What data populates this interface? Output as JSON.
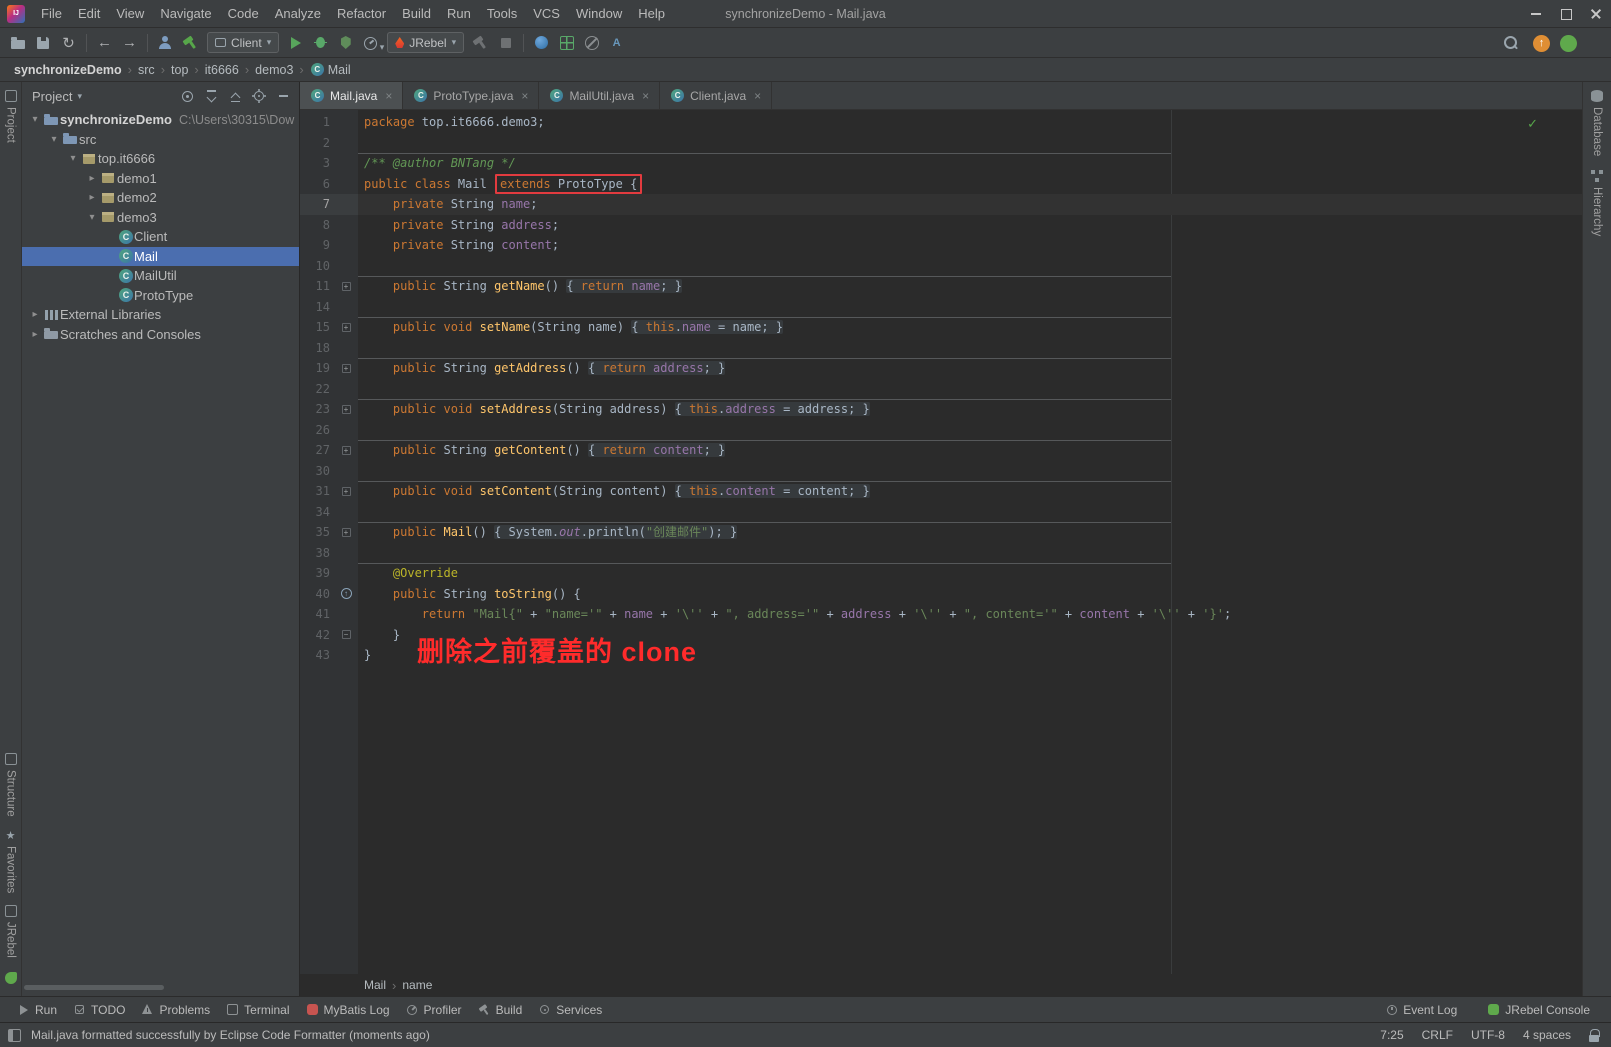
{
  "colors": {
    "selection": "#4B6EAF",
    "highlight_red": "#E23B3F",
    "note_red": "#FF2B2B",
    "keyword": "#CC7832",
    "string": "#6A8759",
    "field": "#9876AA",
    "method": "#FFC66B",
    "comment": "#629755",
    "annotation": "#BBB529",
    "text": "#A9B7C6"
  },
  "window": {
    "title": "synchronizeDemo - Mail.java",
    "menus": [
      "File",
      "Edit",
      "View",
      "Navigate",
      "Code",
      "Analyze",
      "Refactor",
      "Build",
      "Run",
      "Tools",
      "VCS",
      "Window",
      "Help"
    ]
  },
  "toolbar": {
    "run_config_label": "Client",
    "rebel_label": "JRebel",
    "items": [
      {
        "type": "icon",
        "name": "open-file-icon",
        "k": "open"
      },
      {
        "type": "icon",
        "name": "save-all-icon",
        "k": "save"
      },
      {
        "type": "icon",
        "name": "sync-icon",
        "k": "sync",
        "glyph": "↻"
      },
      {
        "type": "sep"
      },
      {
        "type": "icon",
        "name": "back-icon",
        "k": "back",
        "glyph": "←"
      },
      {
        "type": "icon",
        "name": "forward-icon",
        "k": "fwd",
        "glyph": "→"
      },
      {
        "type": "sep"
      },
      {
        "type": "icon",
        "name": "annotate-user-icon",
        "k": "user"
      },
      {
        "type": "icon",
        "name": "build-project-icon",
        "k": "hammer-green"
      },
      {
        "type": "combo",
        "name": "run-config-select",
        "bind": "run_config_label",
        "icon_k": "app"
      },
      {
        "type": "icon",
        "name": "run-icon",
        "k": "run"
      },
      {
        "type": "icon",
        "name": "debug-icon",
        "k": "bug"
      },
      {
        "type": "icon",
        "name": "coverage-icon",
        "k": "coverage"
      },
      {
        "type": "icon",
        "name": "profiler-icon",
        "k": "profiler",
        "caret": true
      },
      {
        "type": "combo",
        "name": "jrebel-select",
        "bind": "rebel_label",
        "icon_k": "flame"
      },
      {
        "type": "icon",
        "name": "attach-agent-icon",
        "k": "hammer-gray"
      },
      {
        "type": "icon",
        "name": "stop-icon",
        "k": "stop"
      },
      {
        "type": "sep"
      },
      {
        "type": "icon",
        "name": "browser-icon",
        "k": "sphere"
      },
      {
        "type": "icon",
        "name": "mybatis-log-icon",
        "k": "grid"
      },
      {
        "type": "icon",
        "name": "mute-breakpoints-icon",
        "k": "mute"
      },
      {
        "type": "icon",
        "name": "translate-icon",
        "k": "translate",
        "glyph": "A"
      }
    ],
    "right_items": [
      {
        "type": "icon",
        "name": "search-everywhere-icon",
        "k": "search"
      },
      {
        "type": "icon",
        "name": "update-icon",
        "k": "update",
        "glyph": "↑"
      },
      {
        "type": "icon",
        "name": "jrebel-status-icon",
        "k": "rebelstat"
      }
    ]
  },
  "path_bar": {
    "items": [
      "synchronizeDemo",
      "src",
      "top",
      "it6666",
      "demo3",
      "Mail"
    ]
  },
  "stripes": {
    "left_top": [
      "Project"
    ],
    "left_bottom": [
      "Structure",
      "Favorites",
      "JRebel"
    ],
    "right": [
      "Database",
      "Hierarchy"
    ]
  },
  "project": {
    "header": "Project",
    "tree": [
      {
        "label": "synchronizeDemo",
        "suffix": "C:\\Users\\30315\\Dow",
        "level": 0,
        "chevron": "open",
        "icon": "module"
      },
      {
        "label": "src",
        "level": 1,
        "chevron": "open",
        "icon": "folder"
      },
      {
        "label": "top.it6666",
        "level": 2,
        "chevron": "open",
        "icon": "package"
      },
      {
        "label": "demo1",
        "level": 3,
        "chevron": "closed",
        "icon": "package"
      },
      {
        "label": "demo2",
        "level": 3,
        "chevron": "closed",
        "icon": "package"
      },
      {
        "label": "demo3",
        "level": 3,
        "chevron": "open",
        "icon": "package"
      },
      {
        "label": "Client",
        "level": 4,
        "chevron": "none",
        "icon": "class"
      },
      {
        "label": "Mail",
        "level": 4,
        "chevron": "none",
        "icon": "class",
        "selected": true
      },
      {
        "label": "MailUtil",
        "level": 4,
        "chevron": "none",
        "icon": "class"
      },
      {
        "label": "ProtoType",
        "level": 4,
        "chevron": "none",
        "icon": "class"
      },
      {
        "label": "External Libraries",
        "level": 0,
        "chevron": "closed",
        "icon": "library"
      },
      {
        "label": "Scratches and Consoles",
        "level": 0,
        "chevron": "closed",
        "icon": "scratch"
      }
    ]
  },
  "tabs": [
    {
      "label": "Mail.java",
      "active": true
    },
    {
      "label": "ProtoType.java",
      "active": false
    },
    {
      "label": "MailUtil.java",
      "active": false
    },
    {
      "label": "Client.java",
      "active": false
    }
  ],
  "editor": {
    "overlay_note": "删除之前覆盖的 clone",
    "inspection_icon": "✓",
    "lines": [
      {
        "n": "1",
        "t": [
          [
            "kw",
            "package "
          ],
          [
            "pl",
            "top.it6666.demo3;"
          ]
        ]
      },
      {
        "n": "2",
        "t": []
      },
      {
        "n": "3",
        "sep": true,
        "t": [
          [
            "cm",
            "/** @author BNTang */"
          ]
        ]
      },
      {
        "n": "6",
        "t": [
          [
            "kw",
            "public class "
          ],
          [
            "pl",
            "Mail "
          ],
          [
            "@red",
            [
              [
                "kw",
                "extends "
              ],
              [
                "pl",
                "ProtoType "
              ],
              [
                "pl",
                "{"
              ]
            ]
          ]
        ]
      },
      {
        "n": "7",
        "cur": true,
        "t": [
          [
            "kw",
            "    private "
          ],
          [
            "pl",
            "String "
          ],
          [
            "fd",
            "name"
          ],
          [
            "pl",
            ";"
          ]
        ]
      },
      {
        "n": "8",
        "t": [
          [
            "kw",
            "    private "
          ],
          [
            "pl",
            "String "
          ],
          [
            "fd",
            "address"
          ],
          [
            "pl",
            ";"
          ]
        ]
      },
      {
        "n": "9",
        "t": [
          [
            "kw",
            "    private "
          ],
          [
            "pl",
            "String "
          ],
          [
            "fd",
            "content"
          ],
          [
            "pl",
            ";"
          ]
        ]
      },
      {
        "n": "10",
        "t": []
      },
      {
        "n": "11",
        "sep": true,
        "g": "fold",
        "t": [
          [
            "kw",
            "    public "
          ],
          [
            "pl",
            "String "
          ],
          [
            "mt",
            "getName"
          ],
          [
            "pl",
            "() "
          ],
          [
            "@fold",
            [
              [
                "pl",
                "{ "
              ],
              [
                "kw",
                "return "
              ],
              [
                "fd",
                "name"
              ],
              [
                "pl",
                "; }"
              ]
            ]
          ]
        ]
      },
      {
        "n": "14",
        "t": []
      },
      {
        "n": "15",
        "sep": true,
        "g": "fold",
        "t": [
          [
            "kw",
            "    public void "
          ],
          [
            "mt",
            "setName"
          ],
          [
            "pl",
            "(String name) "
          ],
          [
            "@fold",
            [
              [
                "pl",
                "{ "
              ],
              [
                "kw",
                "this"
              ],
              [
                "pl",
                "."
              ],
              [
                "fd",
                "name"
              ],
              [
                "pl",
                " = name; }"
              ]
            ]
          ]
        ]
      },
      {
        "n": "18",
        "t": []
      },
      {
        "n": "19",
        "sep": true,
        "g": "fold",
        "t": [
          [
            "kw",
            "    public "
          ],
          [
            "pl",
            "String "
          ],
          [
            "mt",
            "getAddress"
          ],
          [
            "pl",
            "() "
          ],
          [
            "@fold",
            [
              [
                "pl",
                "{ "
              ],
              [
                "kw",
                "return "
              ],
              [
                "fd",
                "address"
              ],
              [
                "pl",
                "; }"
              ]
            ]
          ]
        ]
      },
      {
        "n": "22",
        "t": []
      },
      {
        "n": "23",
        "sep": true,
        "g": "fold",
        "t": [
          [
            "kw",
            "    public void "
          ],
          [
            "mt",
            "setAddress"
          ],
          [
            "pl",
            "(String address) "
          ],
          [
            "@fold",
            [
              [
                "pl",
                "{ "
              ],
              [
                "kw",
                "this"
              ],
              [
                "pl",
                "."
              ],
              [
                "fd",
                "address"
              ],
              [
                "pl",
                " = address; }"
              ]
            ]
          ]
        ]
      },
      {
        "n": "26",
        "t": []
      },
      {
        "n": "27",
        "sep": true,
        "g": "fold",
        "t": [
          [
            "kw",
            "    public "
          ],
          [
            "pl",
            "String "
          ],
          [
            "mt",
            "getContent"
          ],
          [
            "pl",
            "() "
          ],
          [
            "@fold",
            [
              [
                "pl",
                "{ "
              ],
              [
                "kw",
                "return "
              ],
              [
                "fd",
                "content"
              ],
              [
                "pl",
                "; }"
              ]
            ]
          ]
        ]
      },
      {
        "n": "30",
        "t": []
      },
      {
        "n": "31",
        "sep": true,
        "g": "fold",
        "t": [
          [
            "kw",
            "    public void "
          ],
          [
            "mt",
            "setContent"
          ],
          [
            "pl",
            "(String content) "
          ],
          [
            "@fold",
            [
              [
                "pl",
                "{ "
              ],
              [
                "kw",
                "this"
              ],
              [
                "pl",
                "."
              ],
              [
                "fd",
                "content"
              ],
              [
                "pl",
                " = content; }"
              ]
            ]
          ]
        ]
      },
      {
        "n": "34",
        "t": []
      },
      {
        "n": "35",
        "sep": true,
        "g": "fold",
        "t": [
          [
            "kw",
            "    public "
          ],
          [
            "mt",
            "Mail"
          ],
          [
            "pl",
            "() "
          ],
          [
            "@fold",
            [
              [
                "pl",
                "{ System."
              ],
              [
                "sf",
                "out"
              ],
              [
                "pl",
                ".println("
              ],
              [
                "st",
                "\"创建邮件\""
              ],
              [
                "pl",
                "); }"
              ]
            ]
          ]
        ]
      },
      {
        "n": "38",
        "t": []
      },
      {
        "n": "39",
        "sep": true,
        "t": [
          [
            "an",
            "    @Override"
          ]
        ]
      },
      {
        "n": "40",
        "g": "override",
        "t": [
          [
            "kw",
            "    public "
          ],
          [
            "pl",
            "String "
          ],
          [
            "mt",
            "toString"
          ],
          [
            "pl",
            "() {"
          ]
        ]
      },
      {
        "n": "41",
        "t": [
          [
            "kw",
            "        return "
          ],
          [
            "st",
            "\"Mail{\""
          ],
          [
            "pl",
            " + "
          ],
          [
            "st",
            "\"name='\""
          ],
          [
            "pl",
            " + "
          ],
          [
            "fd",
            "name"
          ],
          [
            "pl",
            " + "
          ],
          [
            "st",
            "'\\''"
          ],
          [
            "pl",
            " + "
          ],
          [
            "st",
            "\", address='\""
          ],
          [
            "pl",
            " + "
          ],
          [
            "fd",
            "address"
          ],
          [
            "pl",
            " + "
          ],
          [
            "st",
            "'\\''"
          ],
          [
            "pl",
            " + "
          ],
          [
            "st",
            "\", content='\""
          ],
          [
            "pl",
            " + "
          ],
          [
            "fd",
            "content"
          ],
          [
            "pl",
            " + "
          ],
          [
            "st",
            "'\\''"
          ],
          [
            "pl",
            " + "
          ],
          [
            "st",
            "'}'"
          ],
          [
            "pl",
            ";"
          ]
        ]
      },
      {
        "n": "42",
        "g": "foldend",
        "t": [
          [
            "pl",
            "    }"
          ]
        ]
      },
      {
        "n": "43",
        "t": [
          [
            "pl",
            "}"
          ]
        ]
      }
    ]
  },
  "editor_breadcrumbs": [
    "Mail",
    "name"
  ],
  "tool_buttons": {
    "left": [
      {
        "label": "Run",
        "icon": "run"
      },
      {
        "label": "TODO",
        "icon": "todo"
      },
      {
        "label": "Problems",
        "icon": "problems"
      },
      {
        "label": "Terminal",
        "icon": "terminal"
      },
      {
        "label": "MyBatis Log",
        "icon": "mybatis"
      },
      {
        "label": "Profiler",
        "icon": "profiler"
      },
      {
        "label": "Build",
        "icon": "build"
      },
      {
        "label": "Services",
        "icon": "services"
      }
    ],
    "right": [
      {
        "label": "Event Log",
        "icon": "event-log"
      },
      {
        "label": "JRebel Console",
        "icon": "jrebel"
      }
    ]
  },
  "status": {
    "message": "Mail.java formatted successfully by Eclipse Code Formatter (moments ago)",
    "caret": "7:25",
    "line_sep": "CRLF",
    "encoding": "UTF-8",
    "indent": "4 spaces"
  }
}
